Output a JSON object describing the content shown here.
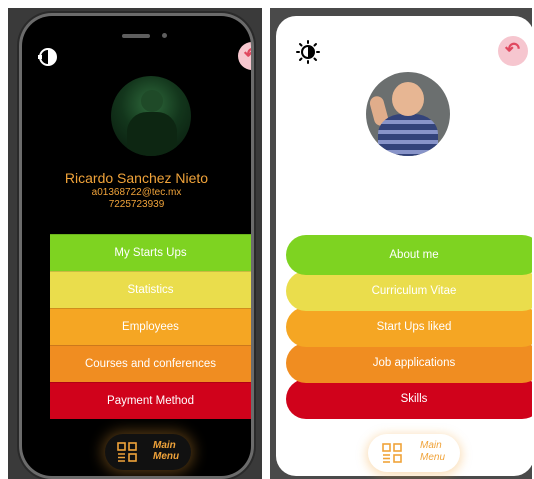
{
  "profile": {
    "name": "Ricardo Sanchez Nieto",
    "email": "a01368722@tec.mx",
    "phone": "7225723939"
  },
  "dark_screen": {
    "menu": [
      {
        "label": "My Starts Ups",
        "color": "#7ed321"
      },
      {
        "label": "Statistics",
        "color": "#eadd4c"
      },
      {
        "label": "Employees",
        "color": "#f5a623"
      },
      {
        "label": "Courses and conferences",
        "color": "#f08d21"
      },
      {
        "label": "Payment Method",
        "color": "#d0021b"
      }
    ],
    "main_menu": {
      "line1": "Main",
      "line2": "Menu"
    }
  },
  "light_screen": {
    "menu": [
      {
        "label": "About me",
        "color": "#7ed321"
      },
      {
        "label": "Curriculum Vitae",
        "color": "#eadd4c"
      },
      {
        "label": "Start Ups liked",
        "color": "#f5a623"
      },
      {
        "label": "Job applications",
        "color": "#f08d21"
      },
      {
        "label": "Skills",
        "color": "#d0021b"
      }
    ],
    "main_menu": {
      "line1": "Main",
      "line2": "Menu"
    }
  },
  "icons": {
    "theme_toggle": "half-sun-icon",
    "back": "reply-arrow-icon",
    "main_menu": "grid-menu-icon"
  },
  "colors": {
    "accent_orange": "#f0a33a",
    "back_pink": "#f7c7cf",
    "back_arrow": "#e0485f"
  }
}
